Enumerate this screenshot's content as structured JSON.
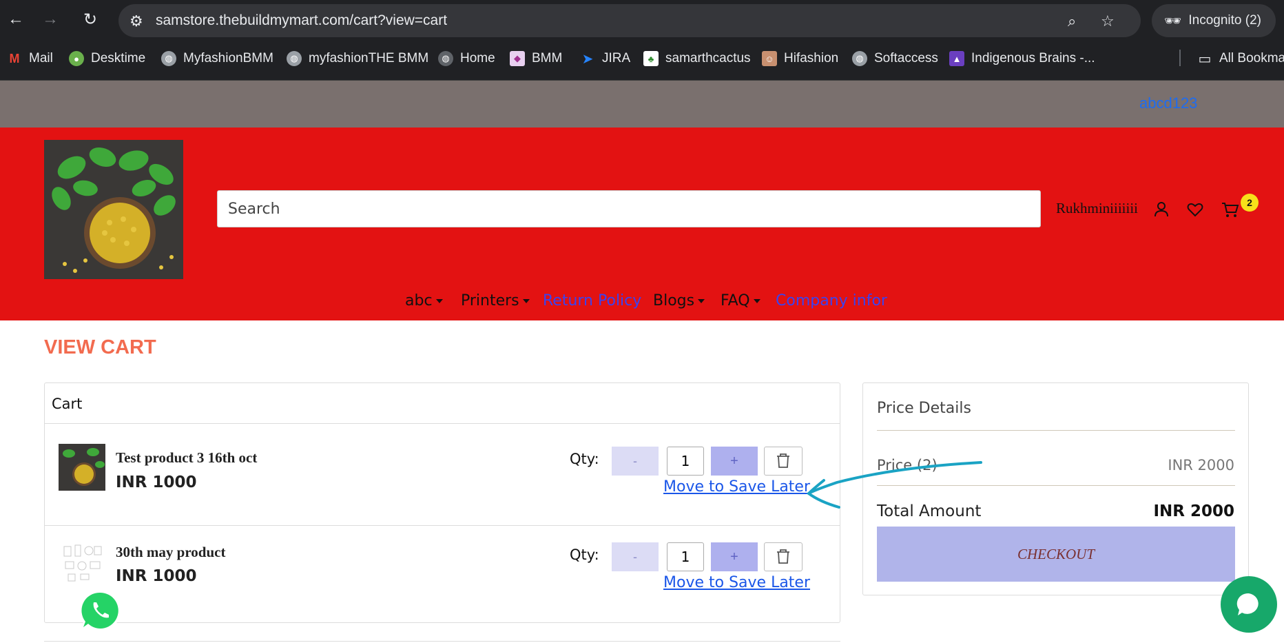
{
  "browser": {
    "url": "samstore.thebuildmymart.com/cart?view=cart",
    "incognito_label": "Incognito (2)",
    "bookmarks": [
      {
        "label": "Mail",
        "icon": "gmail-icon"
      },
      {
        "label": "Desktime",
        "icon": "desktime-icon"
      },
      {
        "label": "MyfashionBMM",
        "icon": "globe-icon"
      },
      {
        "label": "myfashionTHE BMM",
        "icon": "globe-icon"
      },
      {
        "label": "Home",
        "icon": "globe-icon"
      },
      {
        "label": "BMM",
        "icon": "bmm-icon"
      },
      {
        "label": "JIRA",
        "icon": "jira-icon"
      },
      {
        "label": "samarthcactus",
        "icon": "cactus-icon"
      },
      {
        "label": "Hifashion",
        "icon": "hifashion-icon"
      },
      {
        "label": "Softaccess",
        "icon": "globe-icon"
      },
      {
        "label": "Indigenous Brains -...",
        "icon": "indigenous-icon"
      }
    ],
    "all_bookmarks": "All Bookma"
  },
  "site": {
    "topbar_link": "abcd123",
    "search_placeholder": "Search",
    "username": "Rukhminiiiiiii",
    "cart_count": "2",
    "menu": [
      {
        "label": "abc",
        "dropdown": true
      },
      {
        "label": "Printers",
        "dropdown": true
      },
      {
        "label": "Return Policy",
        "dropdown": false
      },
      {
        "label": "Blogs",
        "dropdown": true
      },
      {
        "label": "FAQ",
        "dropdown": true
      },
      {
        "label": "Company infor",
        "dropdown": false
      }
    ]
  },
  "cart": {
    "page_title": "VIEW CART",
    "heading": "Cart",
    "items": [
      {
        "name": "Test product 3 16th oct",
        "price": "INR 1000",
        "qty_label": "Qty:",
        "qty": "1",
        "minus": "-",
        "plus": "+",
        "save_later": "Move to Save Later"
      },
      {
        "name": "30th may product",
        "price": "INR 1000",
        "qty_label": "Qty:",
        "qty": "1",
        "minus": "-",
        "plus": "+",
        "save_later": "Move to Save Later"
      }
    ]
  },
  "price_details": {
    "title": "Price Details",
    "price_label": "Price (2)",
    "price_value": "INR 2000",
    "total_label": "Total Amount",
    "total_value": "INR 2000",
    "checkout_label": "CHECKOUT"
  },
  "colors": {
    "header_red": "#e31212",
    "topbar": "#7a706e",
    "title_orange": "#f26b4f",
    "link_blue": "#1a56e8",
    "checkout_bg": "#b0b4ea",
    "annotation_cyan": "#1aa3c4",
    "whatsapp_green": "#25d366"
  }
}
